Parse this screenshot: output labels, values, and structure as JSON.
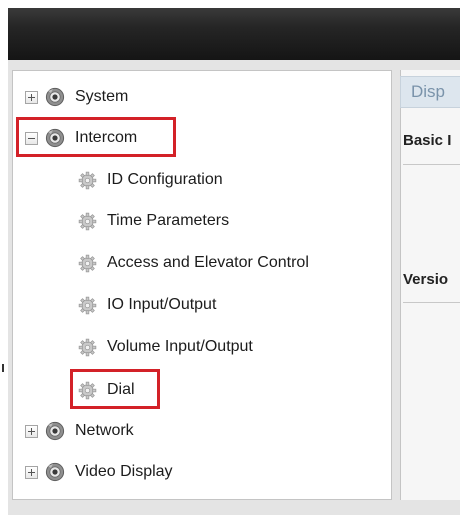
{
  "tree": {
    "items": [
      {
        "label": "System",
        "type": "group",
        "expanded": false,
        "icon": "camera-icon"
      },
      {
        "label": "Intercom",
        "type": "group",
        "expanded": true,
        "icon": "camera-icon",
        "highlighted": true
      },
      {
        "label": "ID Configuration",
        "type": "child",
        "icon": "gear-icon"
      },
      {
        "label": "Time Parameters",
        "type": "child",
        "icon": "gear-icon"
      },
      {
        "label": "Access and Elevator Control",
        "type": "child",
        "icon": "gear-icon"
      },
      {
        "label": "IO Input/Output",
        "type": "child",
        "icon": "gear-icon"
      },
      {
        "label": "Volume Input/Output",
        "type": "child",
        "icon": "gear-icon"
      },
      {
        "label": "Dial",
        "type": "child",
        "icon": "gear-icon",
        "highlighted": true
      },
      {
        "label": "Network",
        "type": "group",
        "expanded": false,
        "icon": "camera-icon"
      },
      {
        "label": "Video Display",
        "type": "group",
        "expanded": false,
        "icon": "camera-icon"
      }
    ]
  },
  "right_panel": {
    "tab_label": "Disp",
    "section_basic": "Basic I",
    "section_version": "Versio"
  },
  "colors": {
    "highlight": "#d32128",
    "titlebar": "#1e1e1e",
    "tab_text": "#7a93aa"
  }
}
